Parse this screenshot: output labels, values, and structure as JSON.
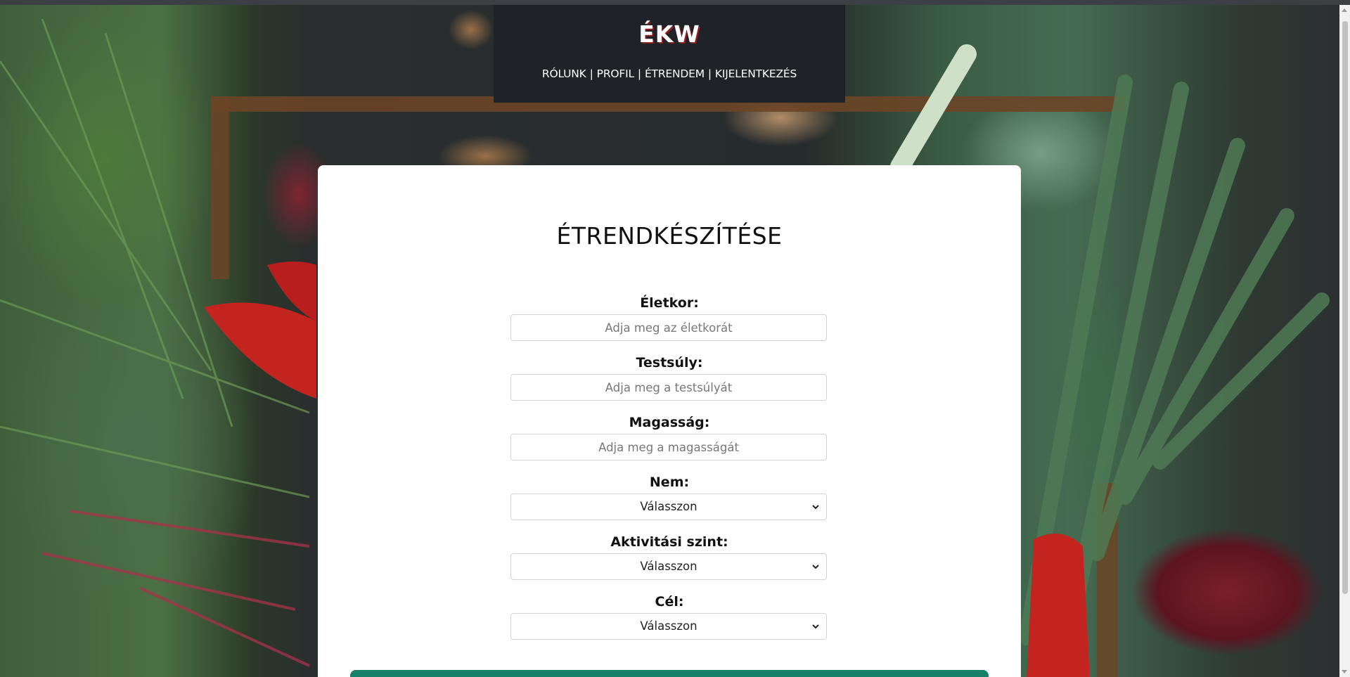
{
  "header": {
    "logo": "ÉKW",
    "nav": {
      "about": "RÓLUNK",
      "profile": "PROFIL",
      "diet": "ÉTRENDEM",
      "logout": "KIJELENTKEZÉS",
      "separator": "|"
    }
  },
  "form": {
    "title": "ÉTRENDKÉSZÍTÉSE",
    "age": {
      "label": "Életkor:",
      "placeholder": "Adja meg az életkorát"
    },
    "weight": {
      "label": "Testsúly:",
      "placeholder": "Adja meg a testsúlyát"
    },
    "height": {
      "label": "Magasság:",
      "placeholder": "Adja meg a magasságát"
    },
    "gender": {
      "label": "Nem:",
      "value": "Válasszon"
    },
    "activity": {
      "label": "Aktivitási szint:",
      "value": "Válasszon"
    },
    "goal": {
      "label": "Cél:",
      "value": "Válasszon"
    }
  },
  "colors": {
    "header_bg": "#1f2227",
    "card_bg": "#ffffff",
    "accent": "#16806a"
  }
}
